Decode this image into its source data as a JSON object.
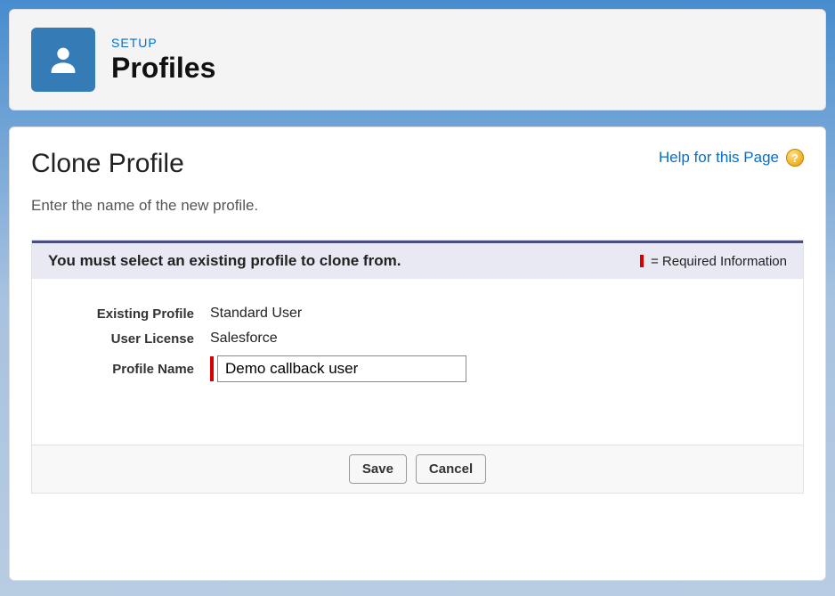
{
  "header": {
    "eyebrow": "SETUP",
    "title": "Profiles"
  },
  "page": {
    "title": "Clone Profile",
    "help_label": "Help for this Page",
    "instruction": "Enter the name of the new profile."
  },
  "panel": {
    "header_message": "You must select an existing profile to clone from.",
    "required_legend": "= Required Information"
  },
  "form": {
    "existing_profile_label": "Existing Profile",
    "existing_profile_value": "Standard User",
    "user_license_label": "User License",
    "user_license_value": "Salesforce",
    "profile_name_label": "Profile Name",
    "profile_name_value": "Demo callback user"
  },
  "buttons": {
    "save": "Save",
    "cancel": "Cancel"
  }
}
